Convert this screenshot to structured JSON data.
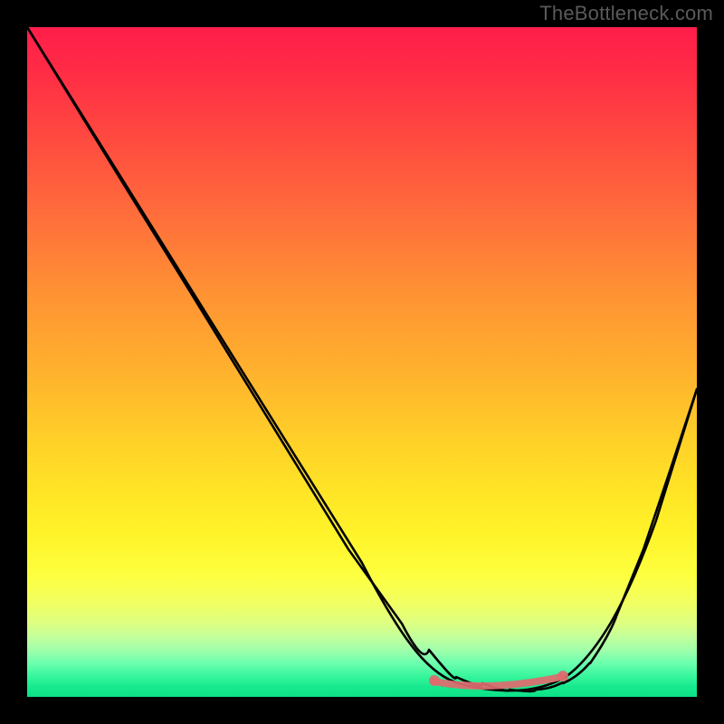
{
  "watermark": "TheBottleneck.com",
  "colors": {
    "background": "#000000",
    "curve_stroke": "#000000",
    "flat_marker": "#e06a6f",
    "gradient_top": "#ff1e4b",
    "gradient_bottom": "#0ce086"
  },
  "chart_data": {
    "type": "line",
    "title": "",
    "xlabel": "",
    "ylabel": "",
    "xlim": [
      0,
      100
    ],
    "ylim": [
      0,
      100
    ],
    "grid": false,
    "legend": false,
    "background": "vertical-rainbow-gradient",
    "series": [
      {
        "name": "bottleneck-curve",
        "x": [
          0,
          8,
          16,
          24,
          32,
          40,
          48,
          56,
          60,
          64,
          68,
          72,
          76,
          80,
          84,
          88,
          92,
          96,
          100
        ],
        "y": [
          100,
          87,
          74,
          61,
          48,
          35,
          22,
          11,
          7,
          4,
          2,
          1,
          1,
          2,
          5,
          12,
          22,
          34,
          46
        ]
      }
    ],
    "flat_region": {
      "x_start": 60,
      "x_end": 82,
      "y": 2
    },
    "annotations": []
  }
}
